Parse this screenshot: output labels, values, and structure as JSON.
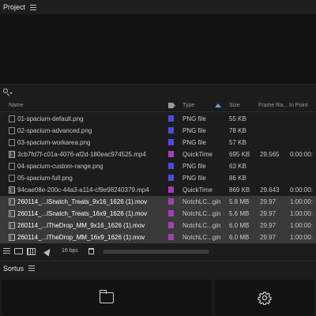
{
  "project_panel": {
    "title": "Project"
  },
  "columns": {
    "name": "Name",
    "type": "Type",
    "size": "Size",
    "frame_rate": "Frame Ra...",
    "in_point": "In Point"
  },
  "rows": [
    {
      "name": "01-spacium-default.png",
      "swatch": "#4a4ae0",
      "type": "PNG file",
      "size": "55 KB",
      "frame_rate": "",
      "in_point": "",
      "selected": false,
      "kind": "image"
    },
    {
      "name": "02-spacium-advanced.png",
      "swatch": "#4a4ae0",
      "type": "PNG file",
      "size": "78 KB",
      "frame_rate": "",
      "in_point": "",
      "selected": false,
      "kind": "image"
    },
    {
      "name": "03-spacium-workarea.png",
      "swatch": "#4a4ae0",
      "type": "PNG file",
      "size": "57 KB",
      "frame_rate": "",
      "in_point": "",
      "selected": false,
      "kind": "image"
    },
    {
      "name": "3cb7fd7f-c01a-4076-af2d-180eac974525.mp4",
      "swatch": "#a23fb3",
      "type": "QuickTime",
      "size": "695 KB",
      "frame_rate": "29.565",
      "in_point": "0:00:00:",
      "selected": false,
      "kind": "movie"
    },
    {
      "name": "04-spacium-custom-range.png",
      "swatch": "#4a4ae0",
      "type": "PNG file",
      "size": "63 KB",
      "frame_rate": "",
      "in_point": "",
      "selected": false,
      "kind": "image"
    },
    {
      "name": "05-spacium-full.png",
      "swatch": "#4a4ae0",
      "type": "PNG file",
      "size": "86 KB",
      "frame_rate": "",
      "in_point": "",
      "selected": false,
      "kind": "image"
    },
    {
      "name": "94cae08e-200c-44a3-a114-cf9e98240379.mp4",
      "swatch": "#a23fb3",
      "type": "QuickTime",
      "size": "869 KB",
      "frame_rate": "29.643",
      "in_point": "0:00:00:",
      "selected": false,
      "kind": "movie"
    },
    {
      "name": "260114_...lSnatch_Treats_9x16_1626 (1).mov",
      "swatch": "#a23fb3",
      "type": "NotchLC...gin",
      "size": "5.8 MB",
      "frame_rate": "29.97",
      "in_point": "1:00:00:",
      "selected": true,
      "kind": "movie"
    },
    {
      "name": "260114_...lSnatch_Treats_16x9_1626 (1).mov",
      "swatch": "#a23fb3",
      "type": "NotchLC...gin",
      "size": "5.6 MB",
      "frame_rate": "29.97",
      "in_point": "1:00:00:",
      "selected": true,
      "kind": "movie"
    },
    {
      "name": "260114_...lTheDrop_MM_9x16_1626 (1).mov",
      "swatch": "#a23fb3",
      "type": "NotchLC...gin",
      "size": "6.0 MB",
      "frame_rate": "29.97",
      "in_point": "1:00:00:",
      "selected": true,
      "kind": "movie"
    },
    {
      "name": "260114_...lTheDrop_MM_16x9_1626 (1).mov",
      "swatch": "#a23fb3",
      "type": "NotchLC...gin",
      "size": "6.0 MB",
      "frame_rate": "29.97",
      "in_point": "1:00:00:",
      "selected": true,
      "kind": "movie"
    }
  ],
  "toolbar": {
    "bit_depth": "16 bpc"
  },
  "sortus_panel": {
    "title": "Sortus"
  },
  "icons": {
    "search": "search-icon",
    "tag": "tag-icon",
    "folder": "folder-icon",
    "settings": "gear-icon"
  }
}
